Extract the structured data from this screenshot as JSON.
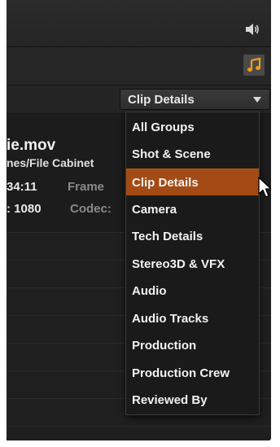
{
  "toolbar": {
    "speaker_icon": "speaker-icon",
    "music_icon": "music-note-icon",
    "music_color": "#f39a1e"
  },
  "metadata_group": {
    "selected_label": "Clip Details",
    "arrow_icon": "triangle-down-icon"
  },
  "clip_info": {
    "name": "ie.mov",
    "path": "nes/File Cabinet",
    "duration_value": "34:11",
    "frame_label": "Frame",
    "resolution_value": ": 1080",
    "codec_label": "Codec:"
  },
  "dropdown": {
    "items": [
      {
        "label": "All Groups"
      },
      {
        "label": "Shot & Scene"
      },
      {
        "label": "Clip Details"
      },
      {
        "label": "Camera"
      },
      {
        "label": "Tech Details"
      },
      {
        "label": "Stereo3D & VFX"
      },
      {
        "label": "Audio"
      },
      {
        "label": "Audio Tracks"
      },
      {
        "label": "Production"
      },
      {
        "label": "Production Crew"
      },
      {
        "label": "Reviewed By"
      }
    ],
    "highlight_color": "#a44a14"
  },
  "cursor_icon": "mouse-pointer-icon"
}
